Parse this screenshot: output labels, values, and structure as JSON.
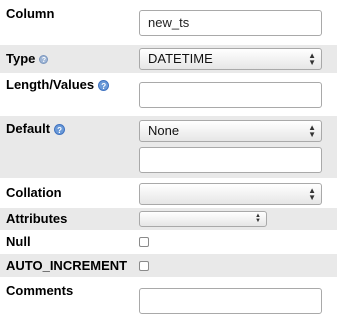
{
  "column": {
    "label": "Column",
    "value": "new_ts"
  },
  "type": {
    "label": "Type",
    "help": "?",
    "value": "DATETIME"
  },
  "length_values": {
    "label": "Length/Values",
    "help": "?",
    "value": ""
  },
  "default": {
    "label": "Default",
    "help": "?",
    "value": "None",
    "custom_value": ""
  },
  "collation": {
    "label": "Collation",
    "value": ""
  },
  "attributes": {
    "label": "Attributes",
    "value": ""
  },
  "null": {
    "label": "Null",
    "checked": false
  },
  "auto_increment": {
    "label": "AUTO_INCREMENT",
    "checked": false
  },
  "comments": {
    "label": "Comments",
    "value": ""
  },
  "icons": {
    "help": "help-icon",
    "select_arrows": "up-down-arrows-icon"
  }
}
